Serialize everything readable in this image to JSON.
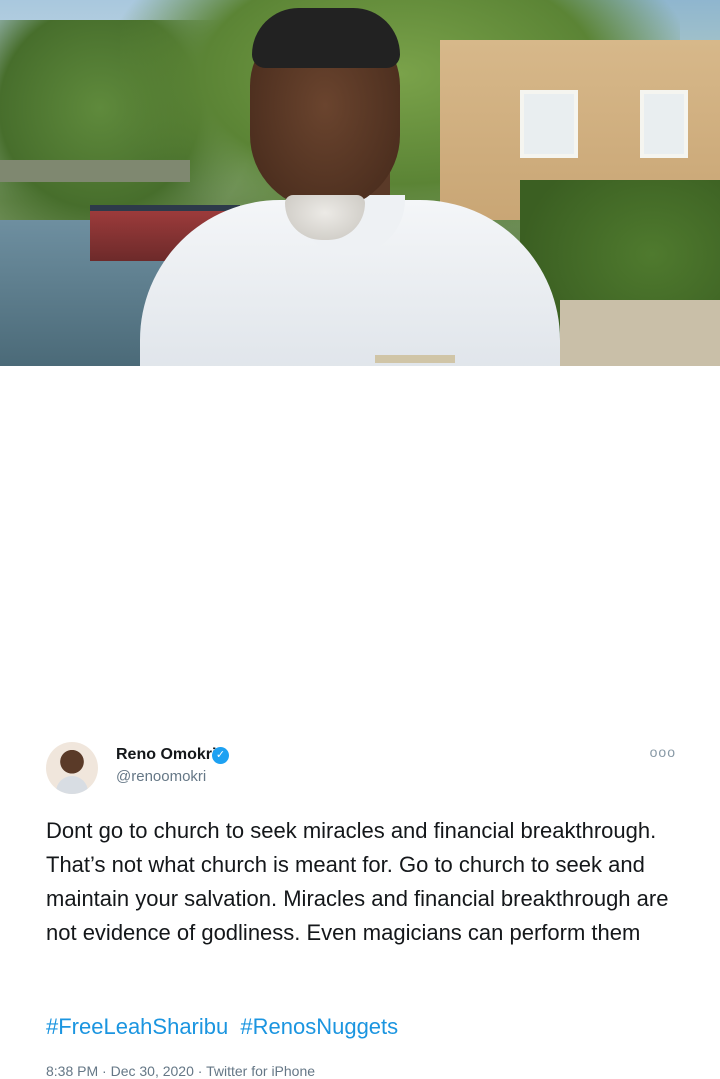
{
  "tweet": {
    "author_name": "Reno Omokri",
    "handle": "@renoomokri",
    "more_icon": "more-dots-icon",
    "text": "Dont go to church to seek miracles and financial breakthrough. That’s not what church is meant for. Go to church to seek and maintain your salvation. Miracles and financial breakthrough are not evidence of godliness. Even magicians can perform them",
    "hashtags": [
      "#FreeLeahSharibu",
      "#RenosNuggets"
    ],
    "time": "8:38 PM",
    "date": "Dec 30, 2020",
    "source": "Twitter for iPhone",
    "separator": "·",
    "verified_icon": "verified-badge-icon"
  },
  "colors": {
    "link": "#1b95e0",
    "verified": "#1da1f2",
    "muted": "#657786"
  }
}
